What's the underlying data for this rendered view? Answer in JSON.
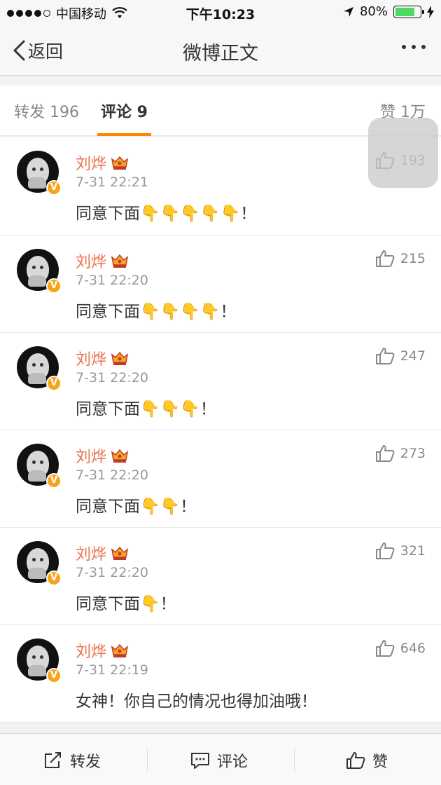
{
  "status_bar": {
    "carrier": "中国移动",
    "time": "下午10:23",
    "battery": "80%",
    "battery_level": 0.8,
    "icons": [
      "signal-dots-icon",
      "wifi-icon",
      "location-arrow-icon",
      "battery-icon",
      "charging-bolt-icon"
    ]
  },
  "nav": {
    "back_label": "返回",
    "title": "微博正文",
    "more_icon": "more-dots-icon"
  },
  "tabs": {
    "repost": "转发 196",
    "comment": "评论 9",
    "like": "赞 1万"
  },
  "comments": [
    {
      "user": "刘烨",
      "time": "7-31 22:21",
      "text": "同意下面👇👇👇👇👇！",
      "likes": "193"
    },
    {
      "user": "刘烨",
      "time": "7-31 22:20",
      "text": "同意下面👇👇👇👇！",
      "likes": "215"
    },
    {
      "user": "刘烨",
      "time": "7-31 22:20",
      "text": "同意下面👇👇👇！",
      "likes": "247"
    },
    {
      "user": "刘烨",
      "time": "7-31 22:20",
      "text": "同意下面👇👇！",
      "likes": "273"
    },
    {
      "user": "刘烨",
      "time": "7-31 22:20",
      "text": "同意下面👇！",
      "likes": "321"
    },
    {
      "user": "刘烨",
      "time": "7-31 22:19",
      "text": "女神！你自己的情况也得加油哦！",
      "likes": "646"
    }
  ],
  "verified_badge": "V",
  "bottom_bar": {
    "repost": "转发",
    "comment": "评论",
    "like": "赞"
  },
  "colors": {
    "accent": "#ff8200",
    "username": "#eb7350",
    "badge": "#f7a41c",
    "battery": "#4cd964"
  }
}
